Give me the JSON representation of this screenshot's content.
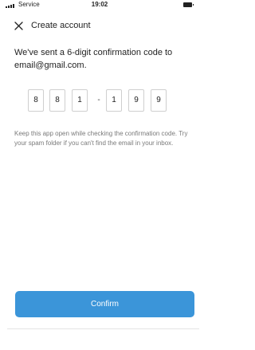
{
  "status_bar": {
    "carrier": "Service",
    "time": "19:02",
    "icons": [
      "signal-bars-icon",
      "battery-icon"
    ]
  },
  "header": {
    "title": "Create account",
    "close_icon": "close-icon"
  },
  "message": {
    "line1": "We've sent a 6-digit confirmation code to",
    "line2": "email@gmail.com."
  },
  "code": {
    "digits": [
      "8",
      "8",
      "1",
      "1",
      "9",
      "9"
    ],
    "separator": "-"
  },
  "help_text": "Keep this app open while checking the confirmation code. Try your spam folder if you can't find the email in your inbox.",
  "confirm_button": {
    "label": "Confirm",
    "color": "#3b95d9"
  }
}
